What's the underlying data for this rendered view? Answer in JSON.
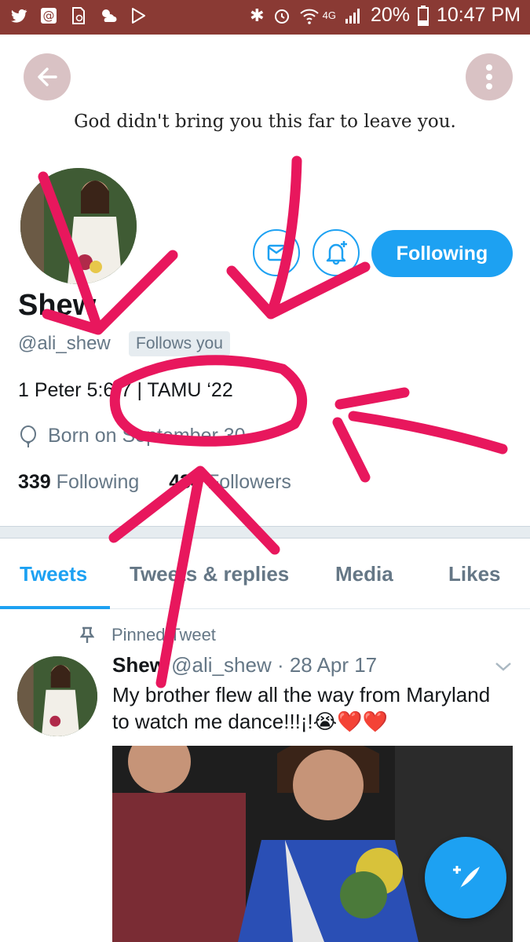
{
  "status_bar": {
    "network": "4G",
    "battery": "20%",
    "time": "10:47 PM"
  },
  "banner": {
    "quote": "God didn't bring you this far to leave you."
  },
  "profile": {
    "display_name": "Shew",
    "handle": "@ali_shew",
    "follows_you": "Follows you",
    "following_button": "Following",
    "bio": "1 Peter 5:6-7 | TAMU ‘22",
    "birth": "Born on September 30",
    "following_count": "339",
    "following_label": "Following",
    "followers_count": "434",
    "followers_label": "Followers"
  },
  "tabs": [
    {
      "label": "Tweets"
    },
    {
      "label": "Tweets & replies"
    },
    {
      "label": "Media"
    },
    {
      "label": "Likes"
    }
  ],
  "pinned_tweet": {
    "pinned_label": "Pinned Tweet",
    "author": "Shew",
    "meta": "@ali_shew · 28 Apr 17",
    "text": "My brother flew all the way from Maryland to watch me dance!!!¡!😭❤️❤️"
  },
  "colors": {
    "accent": "#1da1f2",
    "status_bar": "#8a3a34",
    "annotation": "#e8175d"
  }
}
